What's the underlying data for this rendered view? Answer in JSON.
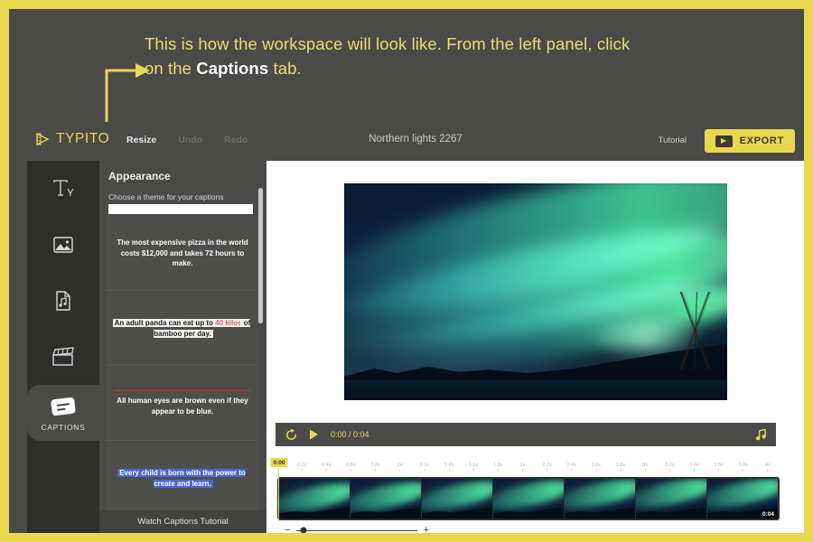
{
  "annotation": {
    "line1": "This is how the workspace will look like. From the left panel, click",
    "line2_prefix": "on the ",
    "line2_bold": "Captions",
    "line2_suffix": " tab.",
    "color": "#eedd6e",
    "bold_color": "#ffffff"
  },
  "app": {
    "logo": "TYPITO",
    "project_title": "Northern lights 2267",
    "toolbar": [
      {
        "label": "Resize",
        "enabled": true
      },
      {
        "label": "Undo",
        "enabled": false
      },
      {
        "label": "Redo",
        "enabled": false
      }
    ],
    "tutorial_label": "Tutorial",
    "export_label": "EXPORT",
    "accent_color": "#e9d84f"
  },
  "rail": {
    "items": [
      {
        "icon": "text-icon",
        "label": "",
        "active": false
      },
      {
        "icon": "image-icon",
        "label": "",
        "active": false
      },
      {
        "icon": "audio-icon",
        "label": "",
        "active": false
      },
      {
        "icon": "video-clapper-icon",
        "label": "",
        "active": false
      },
      {
        "icon": "captions-icon",
        "label": "CAPTIONS",
        "active": true
      }
    ]
  },
  "panel": {
    "title": "Appearance",
    "select_label": "Choose a theme for your captions",
    "select_value": "",
    "watch_tutorial": "Watch Captions Tutorial",
    "themes": [
      {
        "style": "plain-white",
        "text": "The most expensive pizza in the world costs $12,000 and takes 72 hours to make."
      },
      {
        "style": "white-box-black-text",
        "text_before": "An adult panda can eat up to ",
        "highlight": "40 kilos",
        "text_after": " of bamboo per day.",
        "highlight_color": "#d9616d"
      },
      {
        "style": "red-rule-above",
        "text": "All human eyes are brown even if they appear to be blue.",
        "rule_color": "#c0392b"
      },
      {
        "style": "blue-highlight",
        "text": "Every child is born with the power to create and learn.",
        "highlight_color": "#4a67d8"
      }
    ]
  },
  "player": {
    "replay_icon": "replay-icon",
    "play_icon": "play-icon",
    "timecode": "0:00 / 0:04",
    "audio_icon": "music-note-icon"
  },
  "timeline": {
    "playhead_label": "0:00",
    "end_label": "0:04",
    "ticks": [
      "0.2s",
      "0.4s",
      "0.6s",
      "0.8s",
      "1s",
      "1.2s",
      "1.4s",
      "1.6s",
      "1.8s",
      "2s",
      "2.2s",
      "2.4s",
      "2.6s",
      "2.8s",
      "3s",
      "3.2s",
      "3.4s",
      "3.6s",
      "3.8s",
      "4s"
    ],
    "thumbnail_count": 7,
    "zoom_out_label": "−",
    "zoom_in_label": "+",
    "zoom_value": 6
  }
}
